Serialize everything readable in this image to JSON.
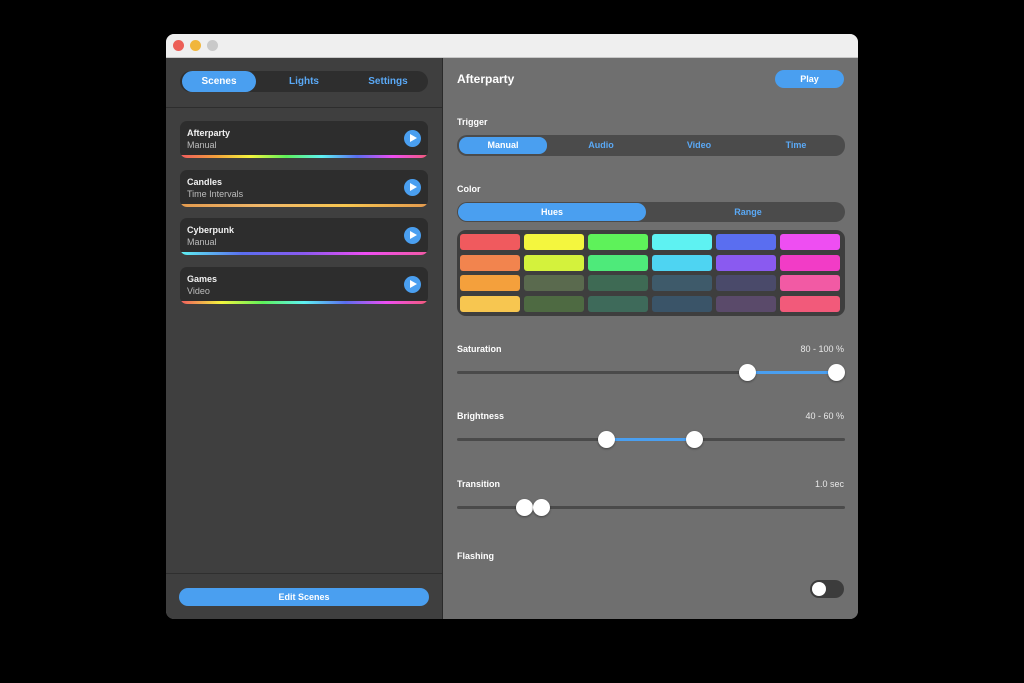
{
  "sidebar": {
    "tabs": [
      {
        "label": "Scenes"
      },
      {
        "label": "Lights"
      },
      {
        "label": "Settings"
      }
    ],
    "scenes": [
      {
        "name": "Afterparty",
        "trigger": "Manual"
      },
      {
        "name": "Candles",
        "trigger": "Time Intervals"
      },
      {
        "name": "Cyberpunk",
        "trigger": "Manual"
      },
      {
        "name": "Games",
        "trigger": "Video"
      }
    ],
    "edit_label": "Edit Scenes"
  },
  "main": {
    "title": "Afterparty",
    "play_label": "Play",
    "trigger": {
      "label": "Trigger",
      "options": [
        "Manual",
        "Audio",
        "Video",
        "Time"
      ],
      "selected": "Manual"
    },
    "color": {
      "label": "Color",
      "options": [
        "Hues",
        "Range"
      ],
      "selected": "Hues"
    },
    "saturation": {
      "label": "Saturation",
      "value_text": "80 - 100 %",
      "low": 80,
      "high": 100
    },
    "brightness": {
      "label": "Brightness",
      "value_text": "40 - 60 %",
      "low": 40,
      "high": 60
    },
    "transition": {
      "label": "Transition",
      "value_text": "1.0 sec"
    },
    "flashing": {
      "label": "Flashing",
      "enabled": false
    }
  },
  "colors": {
    "accent": "#4a9ff0",
    "swatches": [
      [
        "#f05a5e",
        "#f4f63e",
        "#5ef25a",
        "#5ef2f2",
        "#5a6ef0",
        "#ee4ef2"
      ],
      [
        "#f2844e",
        "#d4f23c",
        "#4eea7a",
        "#4ed4f2",
        "#8a5af0",
        "#f23cc6"
      ],
      [
        "#f4a03c",
        "#5a6a4e",
        "#3e6a54",
        "#3e5a6a",
        "#4a4a6a",
        "#f25aa4"
      ],
      [
        "#f7c650",
        "#4e6a42",
        "#3e6a5a",
        "#3a5468",
        "#5a4a6a",
        "#f25a7a"
      ]
    ]
  }
}
